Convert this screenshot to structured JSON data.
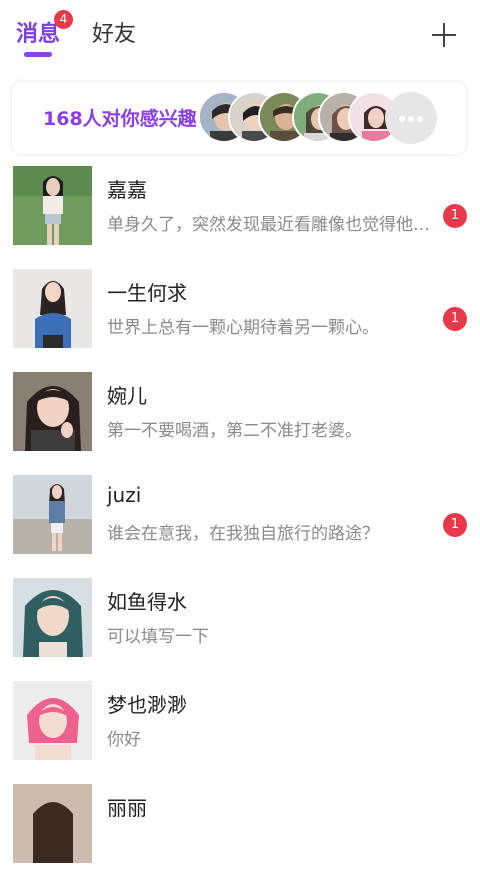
{
  "tabs": {
    "messages": "消息",
    "messages_badge": "4",
    "friends": "好友"
  },
  "interest": {
    "text": "168人对你感兴趣"
  },
  "chats": [
    {
      "name": "嘉嘉",
      "preview": "单身久了，突然发现最近看雕像也觉得他…",
      "unread": "1"
    },
    {
      "name": "一生何求",
      "preview": "世界上总有一颗心期待着另一颗心。",
      "unread": "1"
    },
    {
      "name": "婉儿",
      "preview": "第一不要喝酒，第二不准打老婆。",
      "unread": ""
    },
    {
      "name": "juzi",
      "preview": "谁会在意我，在我独自旅行的路途？",
      "unread": "1"
    },
    {
      "name": "如鱼得水",
      "preview": "可以填写一下",
      "unread": ""
    },
    {
      "name": "梦也渺渺",
      "preview": "你好",
      "unread": ""
    },
    {
      "name": "丽丽",
      "preview": "",
      "unread": ""
    }
  ],
  "colors": {
    "accent": "#7b3fe4",
    "badge": "#e8394a"
  }
}
